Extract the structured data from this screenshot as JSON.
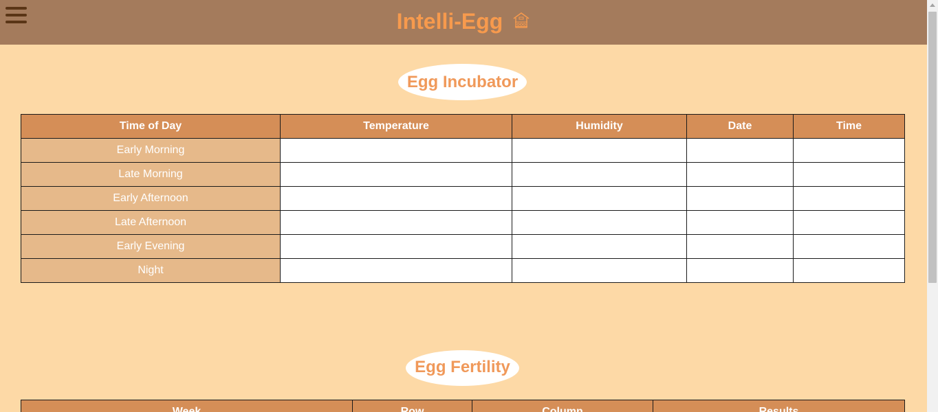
{
  "header": {
    "title": "Intelli-Egg",
    "menu_icon": "hamburger-menu-icon",
    "home_icon": "barn-home-icon",
    "brand_color": "#f79a4d",
    "bar_color": "#a47b5c"
  },
  "incubator": {
    "title": "Egg Incubator",
    "columns": [
      "Time of Day",
      "Temperature",
      "Humidity",
      "Date",
      "Time"
    ],
    "rows": [
      "Early Morning",
      "Late Morning",
      "Early Afternoon",
      "Late Afternoon",
      "Early Evening",
      "Night"
    ]
  },
  "fertility": {
    "title": "Egg Fertility",
    "columns": [
      "Week",
      "Row",
      "Column",
      "Results"
    ]
  },
  "colors": {
    "page_background": "#fdd9a6",
    "header_cell": "#d58e57",
    "row_label_cell": "#e6b98a",
    "title_text": "#f0995a"
  }
}
